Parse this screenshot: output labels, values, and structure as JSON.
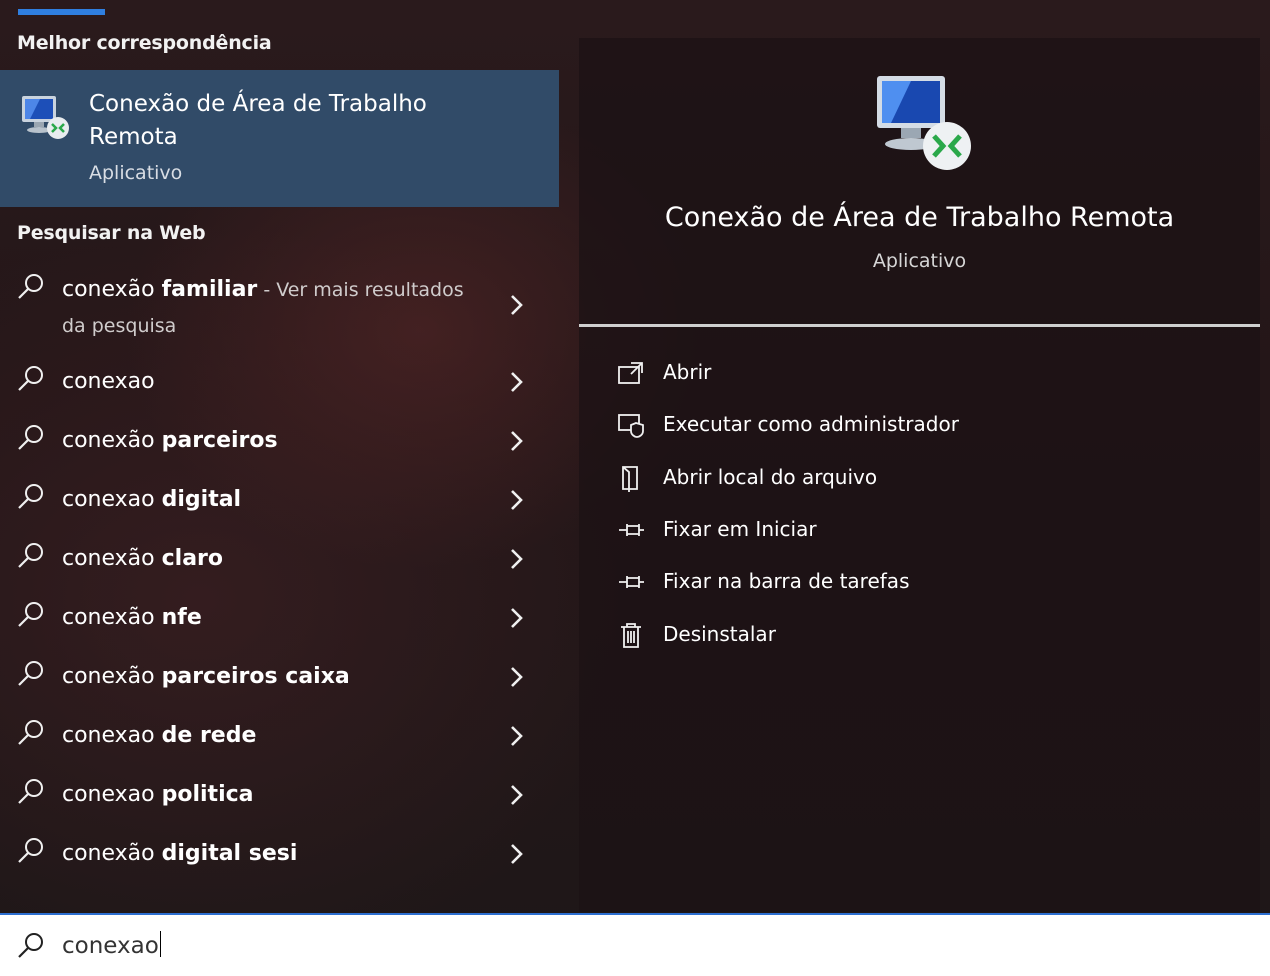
{
  "best_match": {
    "header": "Melhor correspondência",
    "app_name": "Conexão de Área de Trabalho Remota",
    "app_type": "Aplicativo",
    "icon": "remote-desktop-icon"
  },
  "web_search": {
    "header": "Pesquisar na Web",
    "results": [
      {
        "plain": "conexão ",
        "bold": "familiar",
        "suffix": " - Ver mais resultados da pesquisa"
      },
      {
        "plain": "conexao",
        "bold": "",
        "suffix": ""
      },
      {
        "plain": "conexão ",
        "bold": "parceiros",
        "suffix": ""
      },
      {
        "plain": "conexao ",
        "bold": "digital",
        "suffix": ""
      },
      {
        "plain": "conexão ",
        "bold": "claro",
        "suffix": ""
      },
      {
        "plain": "conexão ",
        "bold": "nfe",
        "suffix": ""
      },
      {
        "plain": "conexão ",
        "bold": "parceiros caixa",
        "suffix": ""
      },
      {
        "plain": "conexao ",
        "bold": "de rede",
        "suffix": ""
      },
      {
        "plain": "conexao ",
        "bold": "politica",
        "suffix": ""
      },
      {
        "plain": "conexão ",
        "bold": "digital sesi",
        "suffix": ""
      }
    ]
  },
  "detail": {
    "app_name": "Conexão de Área de Trabalho Remota",
    "app_type": "Aplicativo",
    "actions": [
      {
        "label": "Abrir",
        "icon": "open-icon"
      },
      {
        "label": "Executar como administrador",
        "icon": "run-as-admin-icon"
      },
      {
        "label": "Abrir local do arquivo",
        "icon": "file-location-icon"
      },
      {
        "label": "Fixar em Iniciar",
        "icon": "pin-icon"
      },
      {
        "label": "Fixar na barra de tarefas",
        "icon": "pin-icon"
      },
      {
        "label": "Desinstalar",
        "icon": "trash-icon"
      }
    ]
  },
  "search_box": {
    "query": "conexao"
  },
  "colors": {
    "selected_bg": "#314b68",
    "accent": "#2f7fe0"
  }
}
